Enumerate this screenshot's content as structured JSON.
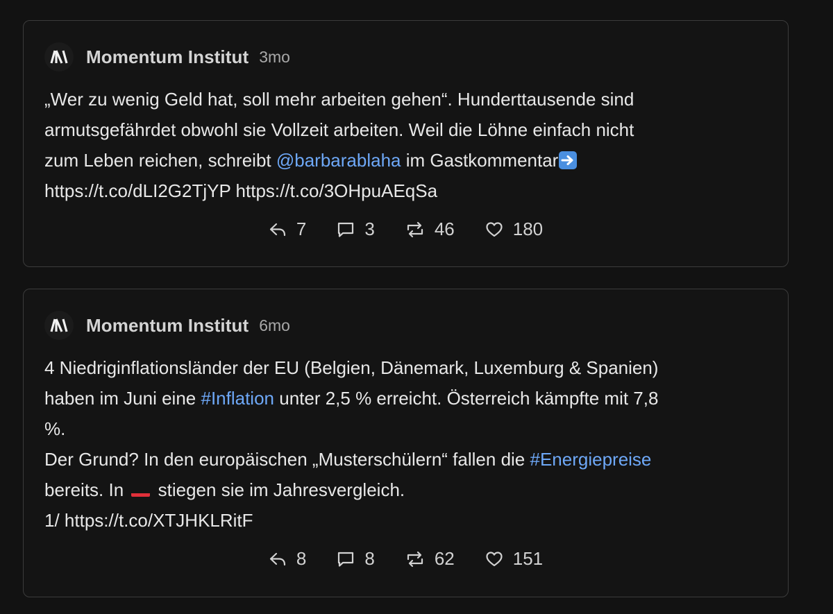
{
  "posts": [
    {
      "author": "Momentum Institut",
      "time": "3mo",
      "avatar_icon": "momentum-logo-icon",
      "lines": [
        {
          "text": "„Wer zu wenig Geld hat, soll mehr arbeiten gehen“. Hunderttausende sind"
        },
        {
          "text": "armutsgefährdet obwohl sie Vollzeit arbeiten. Weil die Löhne einfach nicht"
        },
        {
          "pre": "zum Leben reichen, schreibt ",
          "mention": "@barbarablaha",
          "post": " im Gastkommentar",
          "emoji": "arrow-right-emoji"
        },
        {
          "text": "https://t.co/dLI2G2TjYP https://t.co/3OHpuAEqSa"
        }
      ],
      "stats": {
        "reply": "7",
        "comment": "3",
        "repost": "46",
        "like": "180"
      }
    },
    {
      "author": "Momentum Institut",
      "time": "6mo",
      "avatar_icon": "momentum-logo-icon",
      "lines": [
        {
          "text": "4 Niedriginflationsländer der EU (Belgien, Dänemark, Luxemburg & Spanien)"
        },
        {
          "pre": "haben im Juni eine ",
          "hashtag": "#Inflation",
          "post": " unter 2,5 % erreicht. Österreich kämpfte mit 7,8"
        },
        {
          "text": "%."
        },
        {
          "pre": "Der Grund? In den europäischen „Musterschülern“ fallen die ",
          "hashtag": "#Energiepreise"
        },
        {
          "pre": "bereits. In ",
          "emoji": "austria-flag-emoji",
          "post": " stiegen sie im Jahresvergleich."
        },
        {
          "text": "1/ https://t.co/XTJHKLRitF"
        }
      ],
      "stats": {
        "reply": "8",
        "comment": "8",
        "repost": "62",
        "like": "151"
      }
    }
  ],
  "colors": {
    "background": "#121212",
    "card_border": "#3c3c3c",
    "link": "#6ea8f7",
    "text": "#e8e8e8",
    "muted": "#a9a9a9"
  }
}
